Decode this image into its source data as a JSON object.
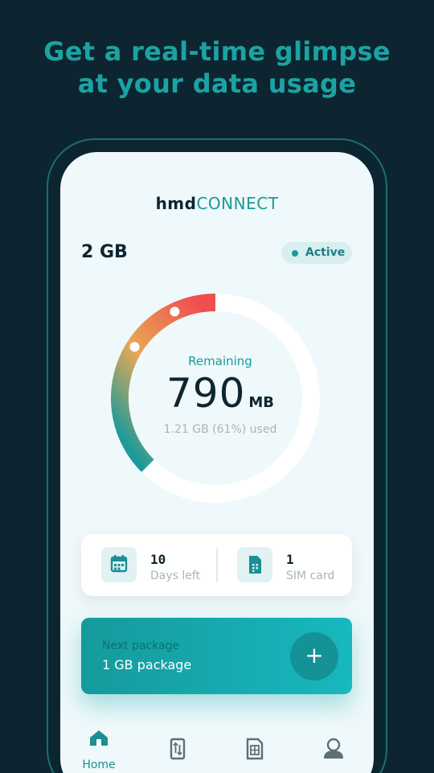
{
  "headline": {
    "line1": "Get a real-time glimpse",
    "line2": "at your data usage"
  },
  "app": {
    "logo_part1": "hmd",
    "logo_part2": "connect"
  },
  "plan": {
    "size": "2 GB",
    "status": "Active"
  },
  "gauge": {
    "label": "Remaining",
    "value": "790",
    "unit": "MB",
    "used_text": "1.21 GB (61%) used",
    "used_fraction": 0.61
  },
  "info": {
    "days_value": "10",
    "days_label": "Days left",
    "sim_value": "1",
    "sim_label": "SIM card"
  },
  "package": {
    "label": "Next package",
    "name": "1 GB package",
    "add_symbol": "+"
  },
  "nav": {
    "home_label": "Home"
  },
  "colors": {
    "background": "#0d2530",
    "accent": "#1a9a9a",
    "gauge_start": "#1a9a9a",
    "gauge_mid": "#e8a955",
    "gauge_end": "#ef4f4f"
  }
}
